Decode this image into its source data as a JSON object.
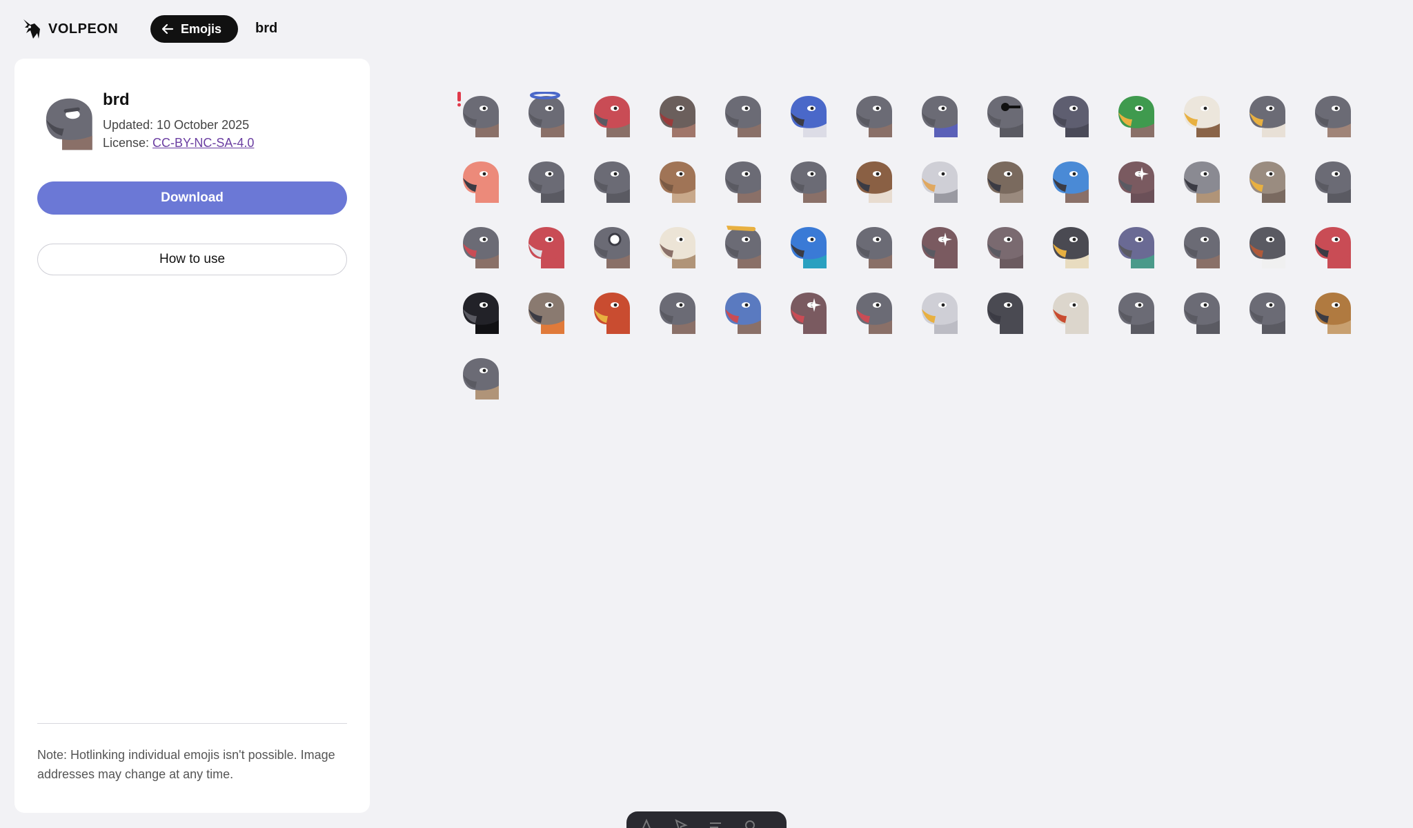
{
  "header": {
    "brand": "VOLPEON",
    "back_label": "Emojis",
    "crumb": "brd"
  },
  "pack": {
    "title": "brd",
    "updated": "Updated: 10 October 2025",
    "license_prefix": "License: ",
    "license_link": "CC-BY-NC-SA-4.0",
    "download_label": "Download",
    "howto_label": "How to use",
    "note": "Note: Hotlinking individual emojis isn't possible. Image addresses may change at any time."
  },
  "colors": {
    "accent": "#6b78d6",
    "panel": "#ffffff",
    "background": "#f2f2f5",
    "link": "#6a3da1"
  },
  "emojis": [
    {
      "icon": "bird-exclaim-icon",
      "head": "#6b6b75",
      "beak": "#5a5a62",
      "neck": "#8a7068",
      "extra": "exclaim"
    },
    {
      "icon": "bird-halo-icon",
      "head": "#6b6b75",
      "beak": "#5a5a62",
      "neck": "#8a7068",
      "extra": "halo"
    },
    {
      "icon": "bird-angry-red-icon",
      "head": "#c94c55",
      "beak": "#5a5a62",
      "neck": "#8a7068",
      "extra": "angry"
    },
    {
      "icon": "bird-vulture-icon",
      "head": "#6b5f5c",
      "beak": "#9a3b3b",
      "neck": "#a0766a",
      "extra": "none"
    },
    {
      "icon": "bird-grey-icon",
      "head": "#6b6b75",
      "beak": "#5a5a62",
      "neck": "#8a7068",
      "extra": "none"
    },
    {
      "icon": "bird-bluejay-icon",
      "head": "#4a68c9",
      "beak": "#3b3b44",
      "neck": "#dcdce6",
      "extra": "none"
    },
    {
      "icon": "bird-smug-icon",
      "head": "#6b6b75",
      "beak": "#5a5a62",
      "neck": "#8a7068",
      "extra": "none"
    },
    {
      "icon": "bird-scarf-icon",
      "head": "#6b6b75",
      "beak": "#5a5a62",
      "neck": "#5a60b8",
      "extra": "none"
    },
    {
      "icon": "bird-glasses-icon",
      "head": "#6b6b75",
      "beak": "#5a5a62",
      "neck": "#5a5a62",
      "extra": "glasses"
    },
    {
      "icon": "bird-dark-icon",
      "head": "#5e5e70",
      "beak": "#4a4a58",
      "neck": "#4a4a58",
      "extra": "none"
    },
    {
      "icon": "bird-mallard-icon",
      "head": "#3f9a4e",
      "beak": "#e8b040",
      "neck": "#8a7068",
      "extra": "none"
    },
    {
      "icon": "bird-eagle-icon",
      "head": "#ece6dc",
      "beak": "#e8b040",
      "neck": "#8a6448",
      "extra": "none"
    },
    {
      "icon": "bird-falcon-icon",
      "head": "#6b6b75",
      "beak": "#e8b040",
      "neck": "#e8e0d6",
      "extra": "none"
    },
    {
      "icon": "bird-plain-icon",
      "head": "#6b6b75",
      "beak": "#5a5a62",
      "neck": "#a08478",
      "extra": "none"
    },
    {
      "icon": "bird-flamingo-icon",
      "head": "#ec8a7a",
      "beak": "#3b3b44",
      "neck": "#ec8a7a",
      "extra": "none"
    },
    {
      "icon": "bird-sleepy-icon",
      "head": "#6b6b75",
      "beak": "#5a5a62",
      "neck": "#5a5a62",
      "extra": "none"
    },
    {
      "icon": "bird-hood-icon",
      "head": "#6b6b75",
      "beak": "#5a5a62",
      "neck": "#5a5a62",
      "extra": "none"
    },
    {
      "icon": "bird-brown-icon",
      "head": "#a07456",
      "beak": "#7a5a44",
      "neck": "#c8a88a",
      "extra": "none"
    },
    {
      "icon": "bird-grin-icon",
      "head": "#6b6b75",
      "beak": "#5a5a62",
      "neck": "#8a7068",
      "extra": "none"
    },
    {
      "icon": "bird-sly-icon",
      "head": "#6b6b75",
      "beak": "#5a5a62",
      "neck": "#8a7068",
      "extra": "none"
    },
    {
      "icon": "bird-hawk-icon",
      "head": "#8a6044",
      "beak": "#3b3b44",
      "neck": "#e8dcd0",
      "extra": "none"
    },
    {
      "icon": "bird-pelican-icon",
      "head": "#cfcfd6",
      "beak": "#e0a860",
      "neck": "#9a9aa2",
      "extra": "none"
    },
    {
      "icon": "bird-owl-icon",
      "head": "#7a6a5e",
      "beak": "#3b3b44",
      "neck": "#9a8a7e",
      "extra": "none"
    },
    {
      "icon": "bird-blue-icon",
      "head": "#4a8ad6",
      "beak": "#3b3b44",
      "neck": "#8a7068",
      "extra": "none"
    },
    {
      "icon": "bird-sparkle-icon",
      "head": "#7a5a60",
      "beak": "#5a5a62",
      "neck": "#6b5058",
      "extra": "sparkle"
    },
    {
      "icon": "bird-kestrel-icon",
      "head": "#8a8a92",
      "beak": "#3b3b44",
      "neck": "#b09478",
      "extra": "none"
    },
    {
      "icon": "bird-spotted-icon",
      "head": "#9a8c80",
      "beak": "#e8b040",
      "neck": "#7a6a60",
      "extra": "none"
    },
    {
      "icon": "bird-thumbsdown-icon",
      "head": "#6b6b75",
      "beak": "#5a5a62",
      "neck": "#5a5a62",
      "extra": "none"
    },
    {
      "icon": "bird-scream-icon",
      "head": "#6b6b75",
      "beak": "#c94c55",
      "neck": "#8a7068",
      "extra": "none"
    },
    {
      "icon": "bird-macaw-icon",
      "head": "#c94c55",
      "beak": "#e0e0e6",
      "neck": "#c94c55",
      "extra": "none"
    },
    {
      "icon": "bird-blueeye-icon",
      "head": "#6b6b75",
      "beak": "#5a5a62",
      "neck": "#8a7068",
      "extra": "bluering"
    },
    {
      "icon": "bird-barnowl-icon",
      "head": "#ece4d6",
      "beak": "#8a7068",
      "neck": "#b09478",
      "extra": "none"
    },
    {
      "icon": "bird-bread-icon",
      "head": "#6b6b75",
      "beak": "#5a5a62",
      "neck": "#8a7068",
      "extra": "bread"
    },
    {
      "icon": "bird-peacock-icon",
      "head": "#3a7ad6",
      "beak": "#3b3b44",
      "neck": "#2aa0c0",
      "extra": "none"
    },
    {
      "icon": "bird-thinking-icon",
      "head": "#6b6b75",
      "beak": "#5a5a62",
      "neck": "#8a7068",
      "extra": "none"
    },
    {
      "icon": "bird-sparkle-dark-icon",
      "head": "#7a5a60",
      "beak": "#5a5a62",
      "neck": "#7a5a60",
      "extra": "sparkle"
    },
    {
      "icon": "bird-shy-icon",
      "head": "#7a6a70",
      "beak": "#5a5a62",
      "neck": "#6b5b60",
      "extra": "none"
    },
    {
      "icon": "bird-penguin-icon",
      "head": "#4a4a52",
      "beak": "#e8b040",
      "neck": "#e8dcc0",
      "extra": "none"
    },
    {
      "icon": "bird-pigeon-icon",
      "head": "#6a6a94",
      "beak": "#5a5a62",
      "neck": "#4a9a8a",
      "extra": "none"
    },
    {
      "icon": "bird-smirk-icon",
      "head": "#6b6b75",
      "beak": "#5a5a62",
      "neck": "#8a7068",
      "extra": "none"
    },
    {
      "icon": "bird-puffin-icon",
      "head": "#5a5a62",
      "beak": "#b05a3a",
      "neck": "#f0f0f0",
      "extra": "none"
    },
    {
      "icon": "bird-cardinal-icon",
      "head": "#c94c55",
      "beak": "#3b3b44",
      "neck": "#c94c55",
      "extra": "none"
    },
    {
      "icon": "bird-reaper-icon",
      "head": "#222228",
      "beak": "#5a5a62",
      "neck": "#111114",
      "extra": "none"
    },
    {
      "icon": "bird-robin-icon",
      "head": "#8a7a70",
      "beak": "#3b3b44",
      "neck": "#e07a3a",
      "extra": "none"
    },
    {
      "icon": "bird-rooster-icon",
      "head": "#c94c30",
      "beak": "#e8b040",
      "neck": "#c94c30",
      "extra": "none"
    },
    {
      "icon": "bird-sad-icon",
      "head": "#6b6b75",
      "beak": "#5a5a62",
      "neck": "#8a7068",
      "extra": "none"
    },
    {
      "icon": "bird-blue-scream-icon",
      "head": "#5a7ac0",
      "beak": "#c94c55",
      "neck": "#8a7068",
      "extra": "none"
    },
    {
      "icon": "bird-yell-sparkle-icon",
      "head": "#7a5a60",
      "beak": "#c94c55",
      "neck": "#7a5a60",
      "extra": "sparkle"
    },
    {
      "icon": "bird-yell-icon",
      "head": "#6b6b75",
      "beak": "#c94c55",
      "neck": "#8a7068",
      "extra": "none"
    },
    {
      "icon": "bird-gull-icon",
      "head": "#cfcfd6",
      "beak": "#e8b040",
      "neck": "#bcbcc4",
      "extra": "none"
    },
    {
      "icon": "bird-crow-icon",
      "head": "#4a4a52",
      "beak": "#3b3b44",
      "neck": "#4a4a52",
      "extra": "none"
    },
    {
      "icon": "bird-heron-icon",
      "head": "#dcd6cc",
      "beak": "#c94c30",
      "neck": "#dcd6cc",
      "extra": "none"
    },
    {
      "icon": "bird-tired-icon",
      "head": "#6b6b75",
      "beak": "#5a5a62",
      "neck": "#5a5a62",
      "extra": "none"
    },
    {
      "icon": "bird-peek-icon",
      "head": "#6b6b75",
      "beak": "#5a5a62",
      "neck": "#5a5a62",
      "extra": "none"
    },
    {
      "icon": "bird-happy-icon",
      "head": "#6b6b75",
      "beak": "#5a5a62",
      "neck": "#5a5a62",
      "extra": "none"
    },
    {
      "icon": "bird-kestrel-brown-icon",
      "head": "#b07a40",
      "beak": "#3b3b44",
      "neck": "#c8a070",
      "extra": "none"
    },
    {
      "icon": "bird-muddy-icon",
      "head": "#6b6b75",
      "beak": "#5a5a62",
      "neck": "#b09478",
      "extra": "none"
    }
  ]
}
